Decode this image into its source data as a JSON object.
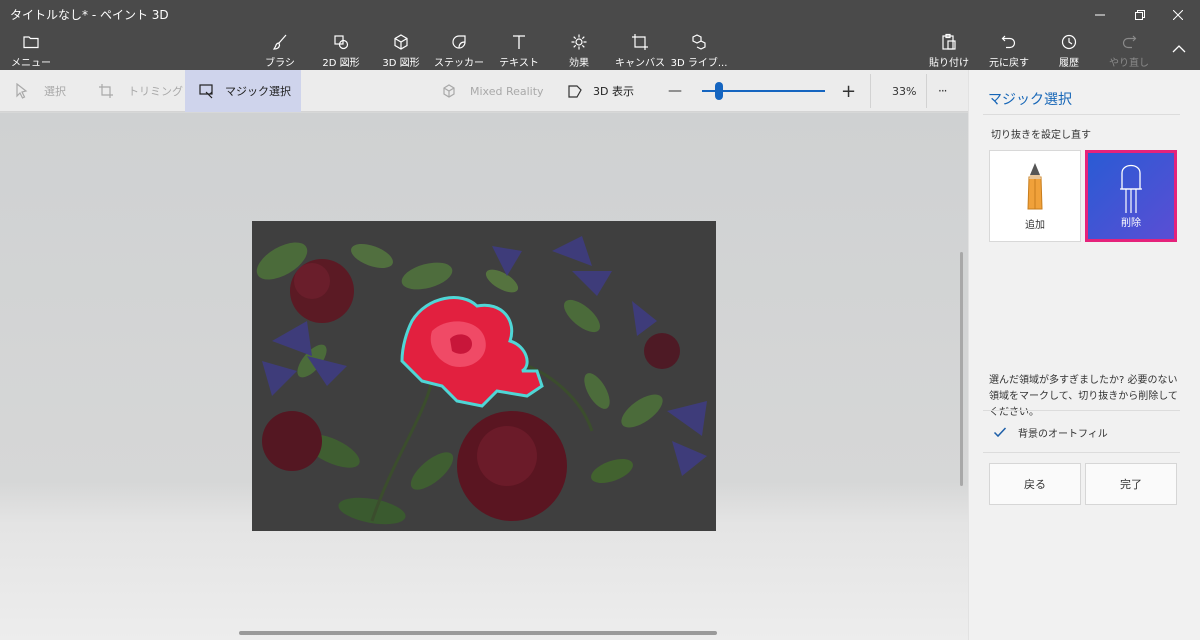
{
  "window": {
    "title": "タイトルなし* - ペイント 3D",
    "controls": [
      "minimize-icon",
      "restore-icon",
      "close-icon"
    ]
  },
  "commandbar": {
    "menu": {
      "label": "メニュー",
      "icon": "folder-icon"
    },
    "tools": [
      {
        "label": "ブラシ",
        "icon": "brush-icon"
      },
      {
        "label": "2D 図形",
        "icon": "2d-shapes-icon"
      },
      {
        "label": "3D 図形",
        "icon": "3d-shapes-icon"
      },
      {
        "label": "ステッカー",
        "icon": "sticker-icon"
      },
      {
        "label": "テキスト",
        "icon": "text-icon"
      },
      {
        "label": "効果",
        "icon": "effects-icon"
      },
      {
        "label": "キャンバス",
        "icon": "canvas-icon"
      },
      {
        "label": "3D ライブ...",
        "icon": "3d-library-icon"
      }
    ],
    "right": [
      {
        "label": "貼り付け",
        "icon": "paste-icon"
      },
      {
        "label": "元に戻す",
        "icon": "undo-icon"
      },
      {
        "label": "履歴",
        "icon": "history-icon"
      },
      {
        "label": "やり直し",
        "icon": "redo-icon",
        "disabled": true
      }
    ]
  },
  "subtoolbar": {
    "select": "選択",
    "crop": "トリミング",
    "magic_select": "マジック選択",
    "mixed_reality": "Mixed Reality",
    "view3d": "3D 表示",
    "zoom_minus": "—",
    "zoom_plus": "+",
    "zoom_percent": "33%",
    "more": "···",
    "zoom_fraction": 0.14
  },
  "panel": {
    "title": "マジック選択",
    "subtitle": "切り抜きを設定し直す",
    "add_label": "追加",
    "remove_label": "削除",
    "help_text": "選んだ領域が多すぎましたか? 必要のない領域をマークして、切り抜きから削除してください。",
    "autofill_label": "背景のオートフィル",
    "autofill_checked": true,
    "back_label": "戻る",
    "done_label": "完了"
  },
  "colors": {
    "accent": "#1565c0",
    "selected_button_border": "#e5227b",
    "selected_button_bg": "#3f55d4",
    "title_bar": "#4a4a4a"
  }
}
